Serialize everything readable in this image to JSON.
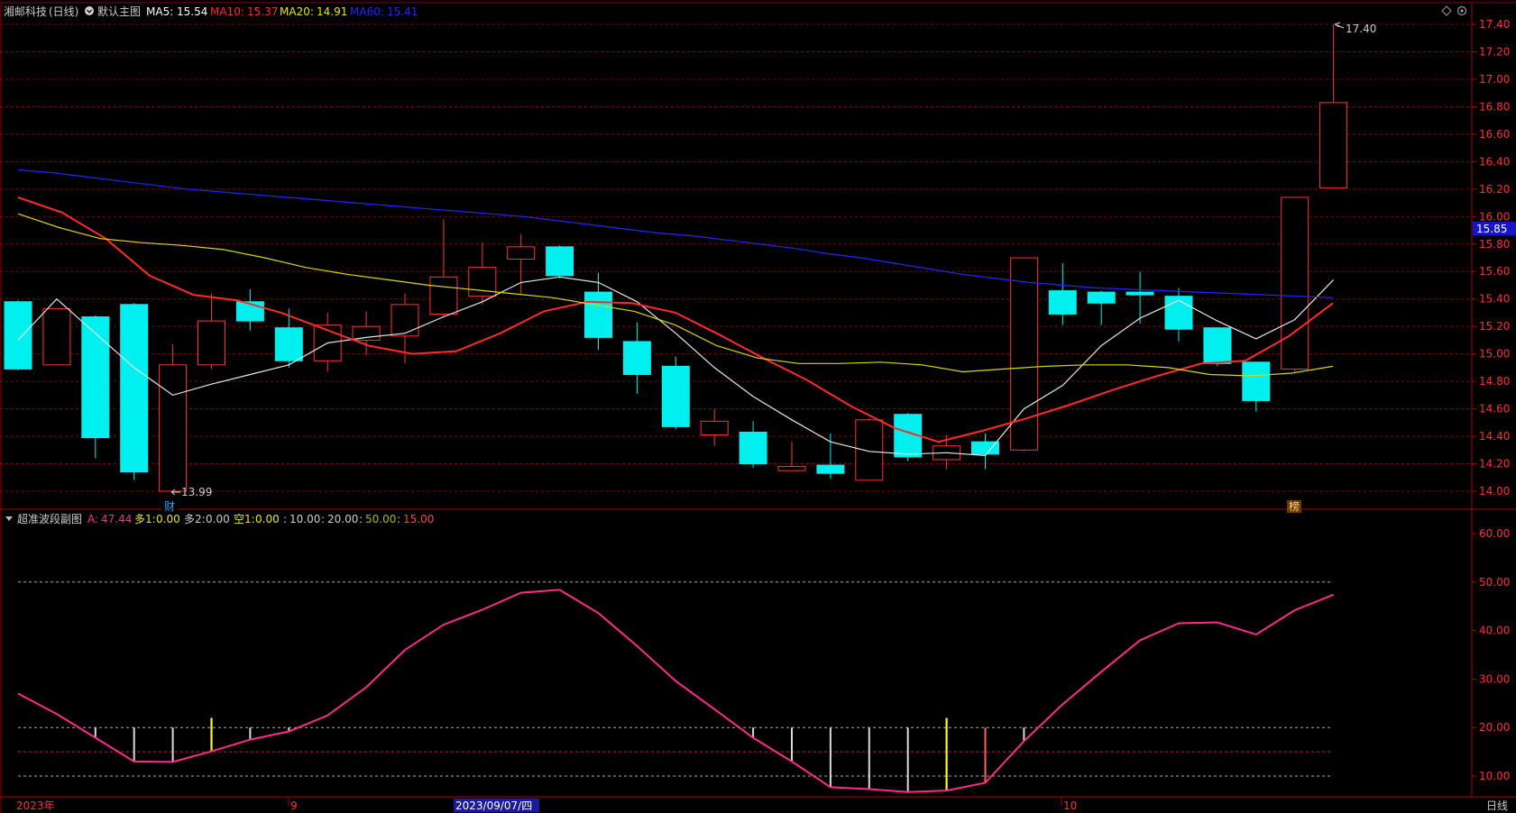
{
  "header": {
    "stock_name": "湘邮科技",
    "period": "(日线)",
    "template_label": "默认主图",
    "ma5_label": "MA5:",
    "ma5_value": "15.54",
    "ma5_color": "#ffffff",
    "ma10_label": "MA10:",
    "ma10_value": "15.37",
    "ma10_color": "#ff2a2a",
    "ma20_label": "MA20:",
    "ma20_value": "14.91",
    "ma20_color": "#e8e800",
    "ma60_label": "MA60:",
    "ma60_value": "15.41",
    "ma60_color": "#2424ff"
  },
  "sub_header": {
    "indicator_name": "超准波段副图",
    "a_label": "A:",
    "a_value": "47.44",
    "a_color": "#ff2a8c",
    "duo1_label": "多1:",
    "duo1_value": "0.00",
    "duo1_color": "#e8e800",
    "duo2_label": "多2:",
    "duo2_value": "0.00",
    "duo2_color": "#cccccc",
    "kong1_label": "空1:",
    "kong1_value": "0.00",
    "kong1_color": "#e8e800",
    "l1": "10.00",
    "l1_color": "#cccccc",
    "l2": "20.00",
    "l2_color": "#cccccc",
    "l3": "50.00",
    "l3_color": "#b5b500",
    "l4": "15.00",
    "l4_color": "#ff4040",
    "sep": ":"
  },
  "top_right_icons": [
    "diamond-icon",
    "settings-icon"
  ],
  "price_label_current": "15.85",
  "high_label": "17.40",
  "low_label": "13.99",
  "marker_cai": "财",
  "marker_bang": "榜",
  "bottom_axis": {
    "labels": [
      "2023年",
      "9",
      "2023/09/07/四",
      "10"
    ],
    "right_label": "日线"
  },
  "colors": {
    "up": "#ff3232",
    "down": "#00f0f0",
    "grid": "#8b0000",
    "axis": "#b00000",
    "a_line": "#ff2a8c"
  },
  "chart_data": [
    {
      "type": "candlestick",
      "title": "湘邮科技 (日线)",
      "ylim": [
        13.92,
        17.52
      ],
      "yticks": [
        "14.00",
        "14.20",
        "14.40",
        "14.60",
        "14.80",
        "15.00",
        "15.20",
        "15.40",
        "15.60",
        "15.80",
        "16.00",
        "16.20",
        "16.40",
        "16.60",
        "16.80",
        "17.00",
        "17.20",
        "17.40"
      ],
      "candles": [
        {
          "o": 15.38,
          "c": 14.89,
          "h": 15.39,
          "l": 14.88
        },
        {
          "o": 14.92,
          "c": 15.33,
          "h": 15.15,
          "l": 15.33
        },
        {
          "o": 15.27,
          "c": 14.39,
          "h": 15.28,
          "l": 14.24
        },
        {
          "o": 15.36,
          "c": 14.14,
          "h": 15.37,
          "l": 14.08
        },
        {
          "o": 14.0,
          "c": 14.92,
          "h": 15.07,
          "l": 13.99
        },
        {
          "o": 14.92,
          "c": 15.24,
          "h": 15.44,
          "l": 14.89
        },
        {
          "o": 15.38,
          "c": 15.24,
          "h": 15.47,
          "l": 15.17
        },
        {
          "o": 15.19,
          "c": 14.95,
          "h": 15.33,
          "l": 14.9
        },
        {
          "o": 14.95,
          "c": 15.21,
          "h": 15.3,
          "l": 14.87
        },
        {
          "o": 15.1,
          "c": 15.2,
          "h": 15.31,
          "l": 14.99
        },
        {
          "o": 15.13,
          "c": 15.36,
          "h": 15.44,
          "l": 14.93
        },
        {
          "o": 15.29,
          "c": 15.56,
          "h": 15.98,
          "l": 15.27
        },
        {
          "o": 15.42,
          "c": 15.63,
          "h": 15.81,
          "l": 15.36
        },
        {
          "o": 15.69,
          "c": 15.78,
          "h": 15.87,
          "l": 15.44
        },
        {
          "o": 15.78,
          "c": 15.57,
          "h": 15.79,
          "l": 15.55
        },
        {
          "o": 15.45,
          "c": 15.12,
          "h": 15.59,
          "l": 15.03
        },
        {
          "o": 15.09,
          "c": 14.85,
          "h": 15.23,
          "l": 14.71
        },
        {
          "o": 14.91,
          "c": 14.47,
          "h": 14.98,
          "l": 14.45
        },
        {
          "o": 14.41,
          "c": 14.51,
          "h": 14.6,
          "l": 14.33
        },
        {
          "o": 14.43,
          "c": 14.2,
          "h": 14.51,
          "l": 14.17
        },
        {
          "o": 14.15,
          "c": 14.18,
          "h": 14.36,
          "l": 14.15
        },
        {
          "o": 14.19,
          "c": 14.13,
          "h": 14.42,
          "l": 14.09
        },
        {
          "o": 14.08,
          "c": 14.52,
          "h": 14.53,
          "l": 14.08
        },
        {
          "o": 14.56,
          "c": 14.25,
          "h": 14.57,
          "l": 14.22
        },
        {
          "o": 14.23,
          "c": 14.33,
          "h": 14.41,
          "l": 14.16
        },
        {
          "o": 14.36,
          "c": 14.27,
          "h": 14.42,
          "l": 14.16
        },
        {
          "o": 14.3,
          "c": 15.7,
          "h": 15.7,
          "l": 14.29
        },
        {
          "o": 15.46,
          "c": 15.29,
          "h": 15.66,
          "l": 15.21
        },
        {
          "o": 15.45,
          "c": 15.37,
          "h": 15.46,
          "l": 15.21
        },
        {
          "o": 15.45,
          "c": 15.43,
          "h": 15.6,
          "l": 15.22
        },
        {
          "o": 15.42,
          "c": 15.18,
          "h": 15.48,
          "l": 15.09
        },
        {
          "o": 15.19,
          "c": 14.93,
          "h": 15.19,
          "l": 14.91
        },
        {
          "o": 14.94,
          "c": 14.66,
          "h": 14.94,
          "l": 14.58
        },
        {
          "o": 14.89,
          "c": 16.14,
          "h": 16.14,
          "l": 14.87
        },
        {
          "o": 16.21,
          "c": 16.83,
          "h": 17.4,
          "l": 16.21
        }
      ],
      "series": [
        {
          "name": "MA5",
          "values": [
            15.1,
            15.4,
            15.15,
            14.9,
            14.7,
            14.78,
            14.85,
            14.92,
            15.08,
            15.12,
            15.15,
            15.27,
            15.38,
            15.52,
            15.56,
            15.52,
            15.38,
            15.15,
            14.9,
            14.69,
            14.52,
            14.36,
            14.29,
            14.27,
            14.28,
            14.26,
            14.6,
            14.77,
            15.06,
            15.26,
            15.39,
            15.24,
            15.11,
            15.25,
            15.54
          ]
        },
        {
          "name": "MA10",
          "values": [
            16.14,
            16.03,
            15.84,
            15.57,
            15.43,
            15.39,
            15.3,
            15.18,
            15.06,
            15.0,
            15.02,
            15.15,
            15.31,
            15.38,
            15.37,
            15.3,
            15.14,
            14.97,
            14.81,
            14.62,
            14.46,
            14.36,
            14.44,
            14.53,
            14.63,
            14.74,
            14.84,
            14.93,
            14.95,
            15.13,
            15.37
          ]
        },
        {
          "name": "MA20",
          "values": [
            16.02,
            15.92,
            15.84,
            15.81,
            15.79,
            15.76,
            15.7,
            15.63,
            15.58,
            15.54,
            15.5,
            15.47,
            15.44,
            15.41,
            15.36,
            15.31,
            15.21,
            15.06,
            14.97,
            14.93,
            14.93,
            14.94,
            14.92,
            14.87,
            14.89,
            14.91,
            14.92,
            14.92,
            14.9,
            14.85,
            14.84,
            14.86,
            14.91
          ]
        },
        {
          "name": "MA60",
          "values": [
            16.34,
            16.32,
            16.29,
            16.26,
            16.23,
            16.2,
            16.18,
            16.16,
            16.14,
            16.12,
            16.1,
            16.08,
            16.06,
            16.04,
            16.02,
            16.0,
            15.97,
            15.94,
            15.91,
            15.88,
            15.86,
            15.83,
            15.8,
            15.77,
            15.73,
            15.7,
            15.66,
            15.62,
            15.58,
            15.55,
            15.52,
            15.5,
            15.48,
            15.47,
            15.46,
            15.45,
            15.44,
            15.43,
            15.42,
            15.41
          ]
        }
      ]
    },
    {
      "type": "line",
      "title": "超准波段副图",
      "ylim": [
        6,
        64
      ],
      "yticks": [
        "10.00",
        "20.00",
        "30.00",
        "40.00",
        "50.00",
        "60.00"
      ],
      "reference_lines": [
        10,
        15,
        20,
        50
      ],
      "series": [
        {
          "name": "A",
          "values": [
            27.0,
            22.8,
            17.9,
            13.0,
            12.9,
            15.1,
            17.5,
            19.2,
            22.5,
            28.3,
            36.0,
            41.2,
            44.3,
            47.8,
            48.4,
            43.6,
            36.8,
            29.6,
            23.8,
            17.9,
            13.0,
            7.7,
            7.3,
            6.7,
            7.0,
            8.6,
            17.2,
            24.8,
            31.5,
            38.0,
            41.5,
            41.7,
            39.2,
            44.2,
            47.4
          ]
        },
        {
          "name": "多1",
          "values": [
            0,
            0,
            0,
            0,
            0,
            22,
            0,
            0,
            0,
            0,
            0,
            0,
            0,
            0,
            0,
            0,
            0,
            0,
            0,
            0,
            0,
            0,
            0,
            0,
            22,
            0,
            0,
            0,
            0,
            0,
            0,
            0,
            0,
            0,
            0
          ]
        },
        {
          "name": "多2",
          "values": [
            0,
            0,
            20,
            20,
            20,
            0,
            20,
            20,
            0,
            0,
            0,
            0,
            0,
            0,
            0,
            0,
            0,
            0,
            0,
            20,
            20,
            20,
            20,
            20,
            0,
            20,
            20,
            0,
            0,
            0,
            0,
            0,
            0,
            0,
            0
          ]
        }
      ]
    }
  ]
}
